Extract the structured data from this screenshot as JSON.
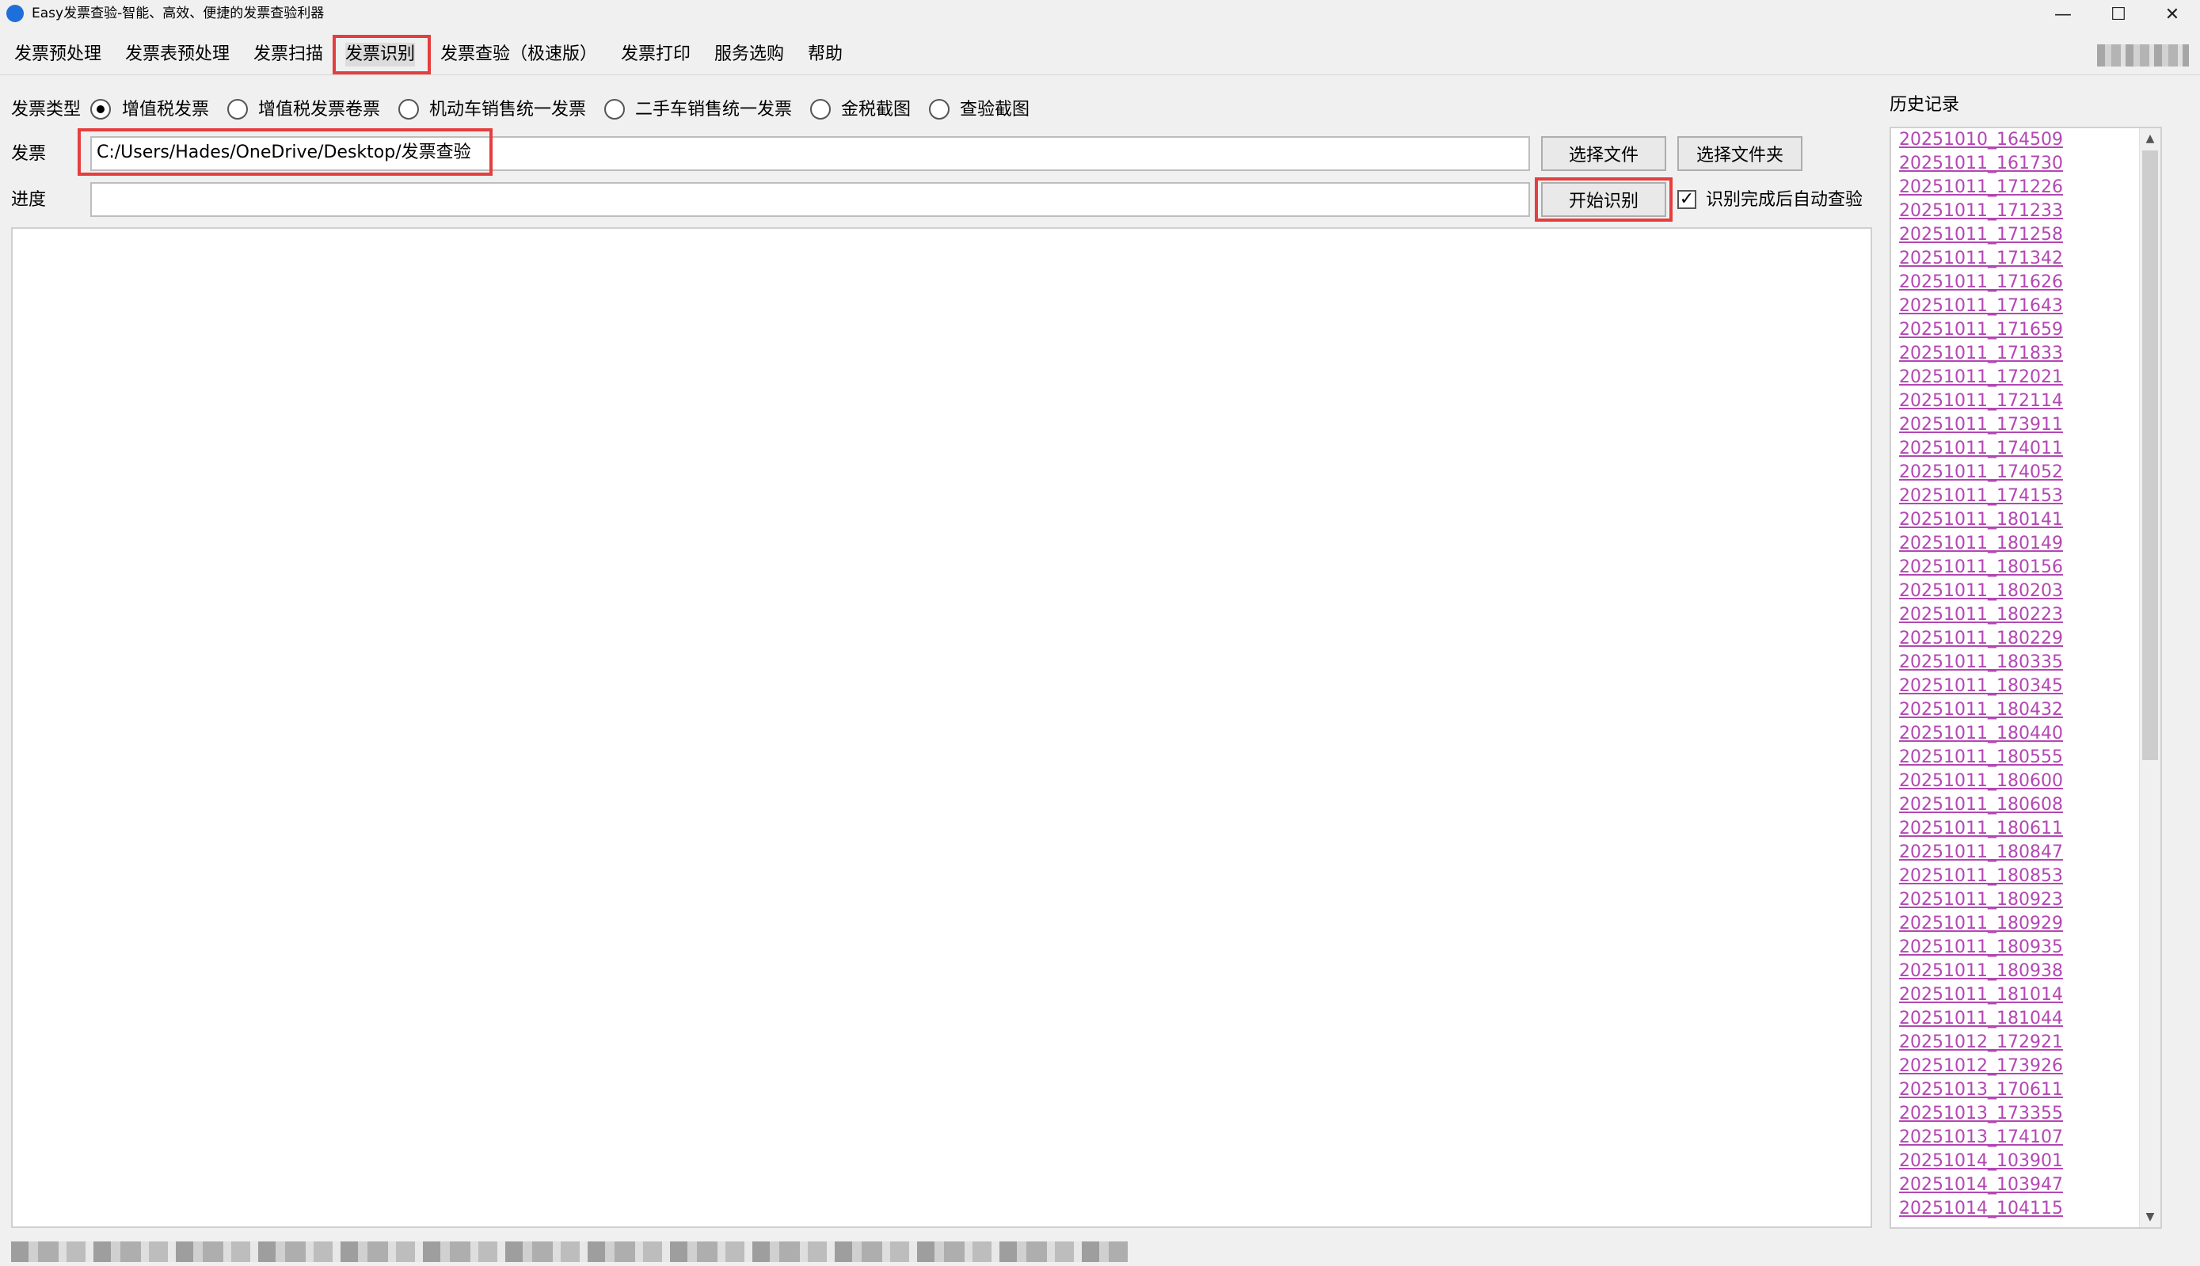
{
  "window": {
    "title": "Easy发票查验-智能、高效、便捷的发票查验利器"
  },
  "menu": [
    {
      "label": "发票预处理"
    },
    {
      "label": "发票表预处理"
    },
    {
      "label": "发票扫描"
    },
    {
      "label": "发票识别"
    },
    {
      "label": "发票查验（极速版）"
    },
    {
      "label": "发票打印"
    },
    {
      "label": "服务选购"
    },
    {
      "label": "帮助"
    }
  ],
  "invoice_type": {
    "label": "发票类型",
    "selected": "增值税发票",
    "options": [
      "增值税发票",
      "增值税发票卷票",
      "机动车销售统一发票",
      "二手车销售统一发票",
      "金税截图",
      "查验截图"
    ]
  },
  "invoice": {
    "label": "发票",
    "path_value": "C:/Users/Hades/OneDrive/Desktop/发票查验",
    "select_file_button": "选择文件",
    "select_folder_button": "选择文件夹"
  },
  "progress": {
    "label": "进度",
    "value": "",
    "start_button": "开始识别",
    "auto_verify_label": "识别完成后自动查验",
    "auto_verify_checked": true
  },
  "history": {
    "title": "历史记录",
    "items": [
      "20251010_164509",
      "20251011_161730",
      "20251011_171226",
      "20251011_171233",
      "20251011_171258",
      "20251011_171342",
      "20251011_171626",
      "20251011_171643",
      "20251011_171659",
      "20251011_171833",
      "20251011_172021",
      "20251011_172114",
      "20251011_173911",
      "20251011_174011",
      "20251011_174052",
      "20251011_174153",
      "20251011_180141",
      "20251011_180149",
      "20251011_180156",
      "20251011_180203",
      "20251011_180223",
      "20251011_180229",
      "20251011_180335",
      "20251011_180345",
      "20251011_180432",
      "20251011_180440",
      "20251011_180555",
      "20251011_180600",
      "20251011_180608",
      "20251011_180611",
      "20251011_180847",
      "20251011_180853",
      "20251011_180923",
      "20251011_180929",
      "20251011_180935",
      "20251011_180938",
      "20251011_181014",
      "20251011_181044",
      "20251012_172921",
      "20251012_173926",
      "20251013_170611",
      "20251013_173355",
      "20251013_174107",
      "20251014_103901",
      "20251014_103947",
      "20251014_104115"
    ]
  },
  "colors": {
    "highlight": "#e53e3e",
    "history_link": "#b347b3",
    "window_bg": "#f0f0f0",
    "app_icon": "#1e6fd9"
  }
}
